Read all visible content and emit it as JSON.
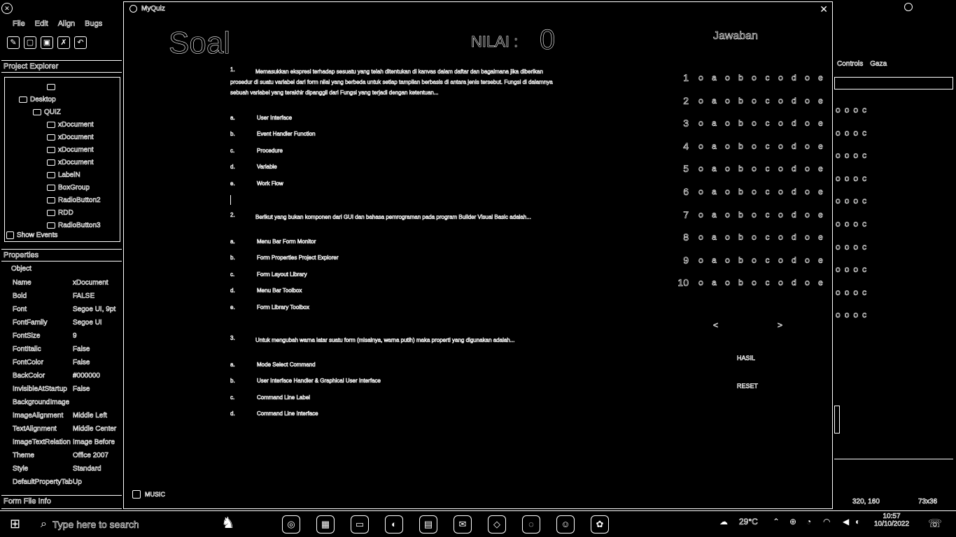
{
  "ide": {
    "menu": [
      "File",
      "Edit",
      "Align",
      "Bugs"
    ],
    "project_explorer_title": "Project Explorer",
    "tree": [
      {
        "label": "",
        "indent": 60
      },
      {
        "label": "Desktop",
        "indent": 20
      },
      {
        "label": "QUIZ",
        "indent": 40
      },
      {
        "label": "xDocument",
        "indent": 60
      },
      {
        "label": "xDocument",
        "indent": 60
      },
      {
        "label": "xDocument",
        "indent": 60
      },
      {
        "label": "xDocument",
        "indent": 60
      },
      {
        "label": "LabelN",
        "indent": 60
      },
      {
        "label": "BoxGroup",
        "indent": 60
      },
      {
        "label": "RadioButton2",
        "indent": 60
      },
      {
        "label": "RDD",
        "indent": 60
      },
      {
        "label": "RadioButton3",
        "indent": 60
      }
    ],
    "show_events_label": "Show Events",
    "properties_title": "Properties",
    "properties_object": "Object",
    "properties": [
      {
        "k": "Name",
        "v": "xDocument"
      },
      {
        "k": "Bold",
        "v": "FALSE"
      },
      {
        "k": "Font",
        "v": "Segoe UI, 9pt"
      },
      {
        "k": "FontFamily",
        "v": "Segoe UI"
      },
      {
        "k": "FontSize",
        "v": "9"
      },
      {
        "k": "FontItalic",
        "v": "False"
      },
      {
        "k": "FontColor",
        "v": "False"
      },
      {
        "k": "BackColor",
        "v": "#000000"
      },
      {
        "k": "InvisibleAtStartup",
        "v": "False"
      },
      {
        "k": "BackgroundImage",
        "v": ""
      },
      {
        "k": "ImageAlignment",
        "v": "Middle Left"
      },
      {
        "k": "TextAlignment",
        "v": "Middle Center"
      },
      {
        "k": "ImageTextRelation",
        "v": "Image Before"
      },
      {
        "k": "Theme",
        "v": "Office 2007"
      },
      {
        "k": "Style",
        "v": "Standard"
      },
      {
        "k": "DefaultPropertyTab",
        "v": "Up"
      }
    ],
    "bottom_tab": "Form File Info"
  },
  "window": {
    "title": "MyQuiz",
    "soal_title": "Soal",
    "nilai_label": "NILAI :",
    "nilai_value": "0",
    "jawaban_title": "Jawaban",
    "questions": [
      {
        "num": "1.",
        "text": "Memasukkan ekspresi terhadap sesuatu yang telah ditentukan di kanvas dalam daftar dan bagaimana jika diberikan prosedur di suatu variabel dari form nilai yang berbeda untuk setiap tampilan berbasis di antara jenis tersebut. Fungsi di dalamnya sebuah variabel yang terakhir dipanggil dari Fungsi yang terjadi dengan ketentuan...",
        "opts": [
          {
            "r": "a.",
            "t": "User Interface"
          },
          {
            "r": "b.",
            "t": "Event Handler Function"
          },
          {
            "r": "c.",
            "t": "Procedure"
          },
          {
            "r": "d.",
            "t": "Variable"
          },
          {
            "r": "e.",
            "t": "Work Flow"
          }
        ]
      },
      {
        "num": "2.",
        "text": "Berikut yang bukan komponen dari GUI dan bahasa pemrograman pada program Builder Visual Basic adalah...",
        "opts": [
          {
            "r": "a.",
            "t": "Menu Bar Form Monitor"
          },
          {
            "r": "b.",
            "t": "Form Properties Project Explorer"
          },
          {
            "r": "c.",
            "t": "Form Layout Library"
          },
          {
            "r": "d.",
            "t": "Menu Bar Toolbox"
          },
          {
            "r": "e.",
            "t": "Form Library Toolbox"
          }
        ]
      },
      {
        "num": "3.",
        "text": "Untuk mengubah warna latar suatu form (misalnya, warna putih) maka properti yang digunakan adalah...",
        "opts": [
          {
            "r": "a.",
            "t": "Mode Select Command"
          },
          {
            "r": "b.",
            "t": "User Interface Handler & Graphical User Interface"
          },
          {
            "r": "c.",
            "t": "Command Line Label"
          },
          {
            "r": "d.",
            "t": "Command Line Interface"
          }
        ]
      }
    ],
    "answer_numbers": [
      "1",
      "2",
      "3",
      "4",
      "5",
      "6",
      "7",
      "8",
      "9",
      "10"
    ],
    "answer_marks": [
      "o",
      "a",
      "o",
      "b",
      "o",
      "c",
      "o",
      "d",
      "o",
      "e"
    ],
    "nav_prev": "<",
    "nav_next": ">",
    "hasil_label": "HASIL",
    "reset_label": "RESET",
    "music_label": "MUSIC"
  },
  "right_panel": {
    "tab1": "Controls",
    "tab2": "Gaza",
    "row_marks": [
      "o",
      "o",
      "o",
      "c"
    ],
    "status_coord": "320, 160",
    "status_size": "73x36"
  },
  "taskbar": {
    "search_placeholder": "Type here to search",
    "apps": [
      "◎",
      "▦",
      "▭",
      "◐",
      "▤",
      "✉",
      "◇",
      "◌",
      "☺",
      "✿"
    ],
    "temp": "29°C",
    "time": "10:57",
    "date": "10/10/2022"
  }
}
